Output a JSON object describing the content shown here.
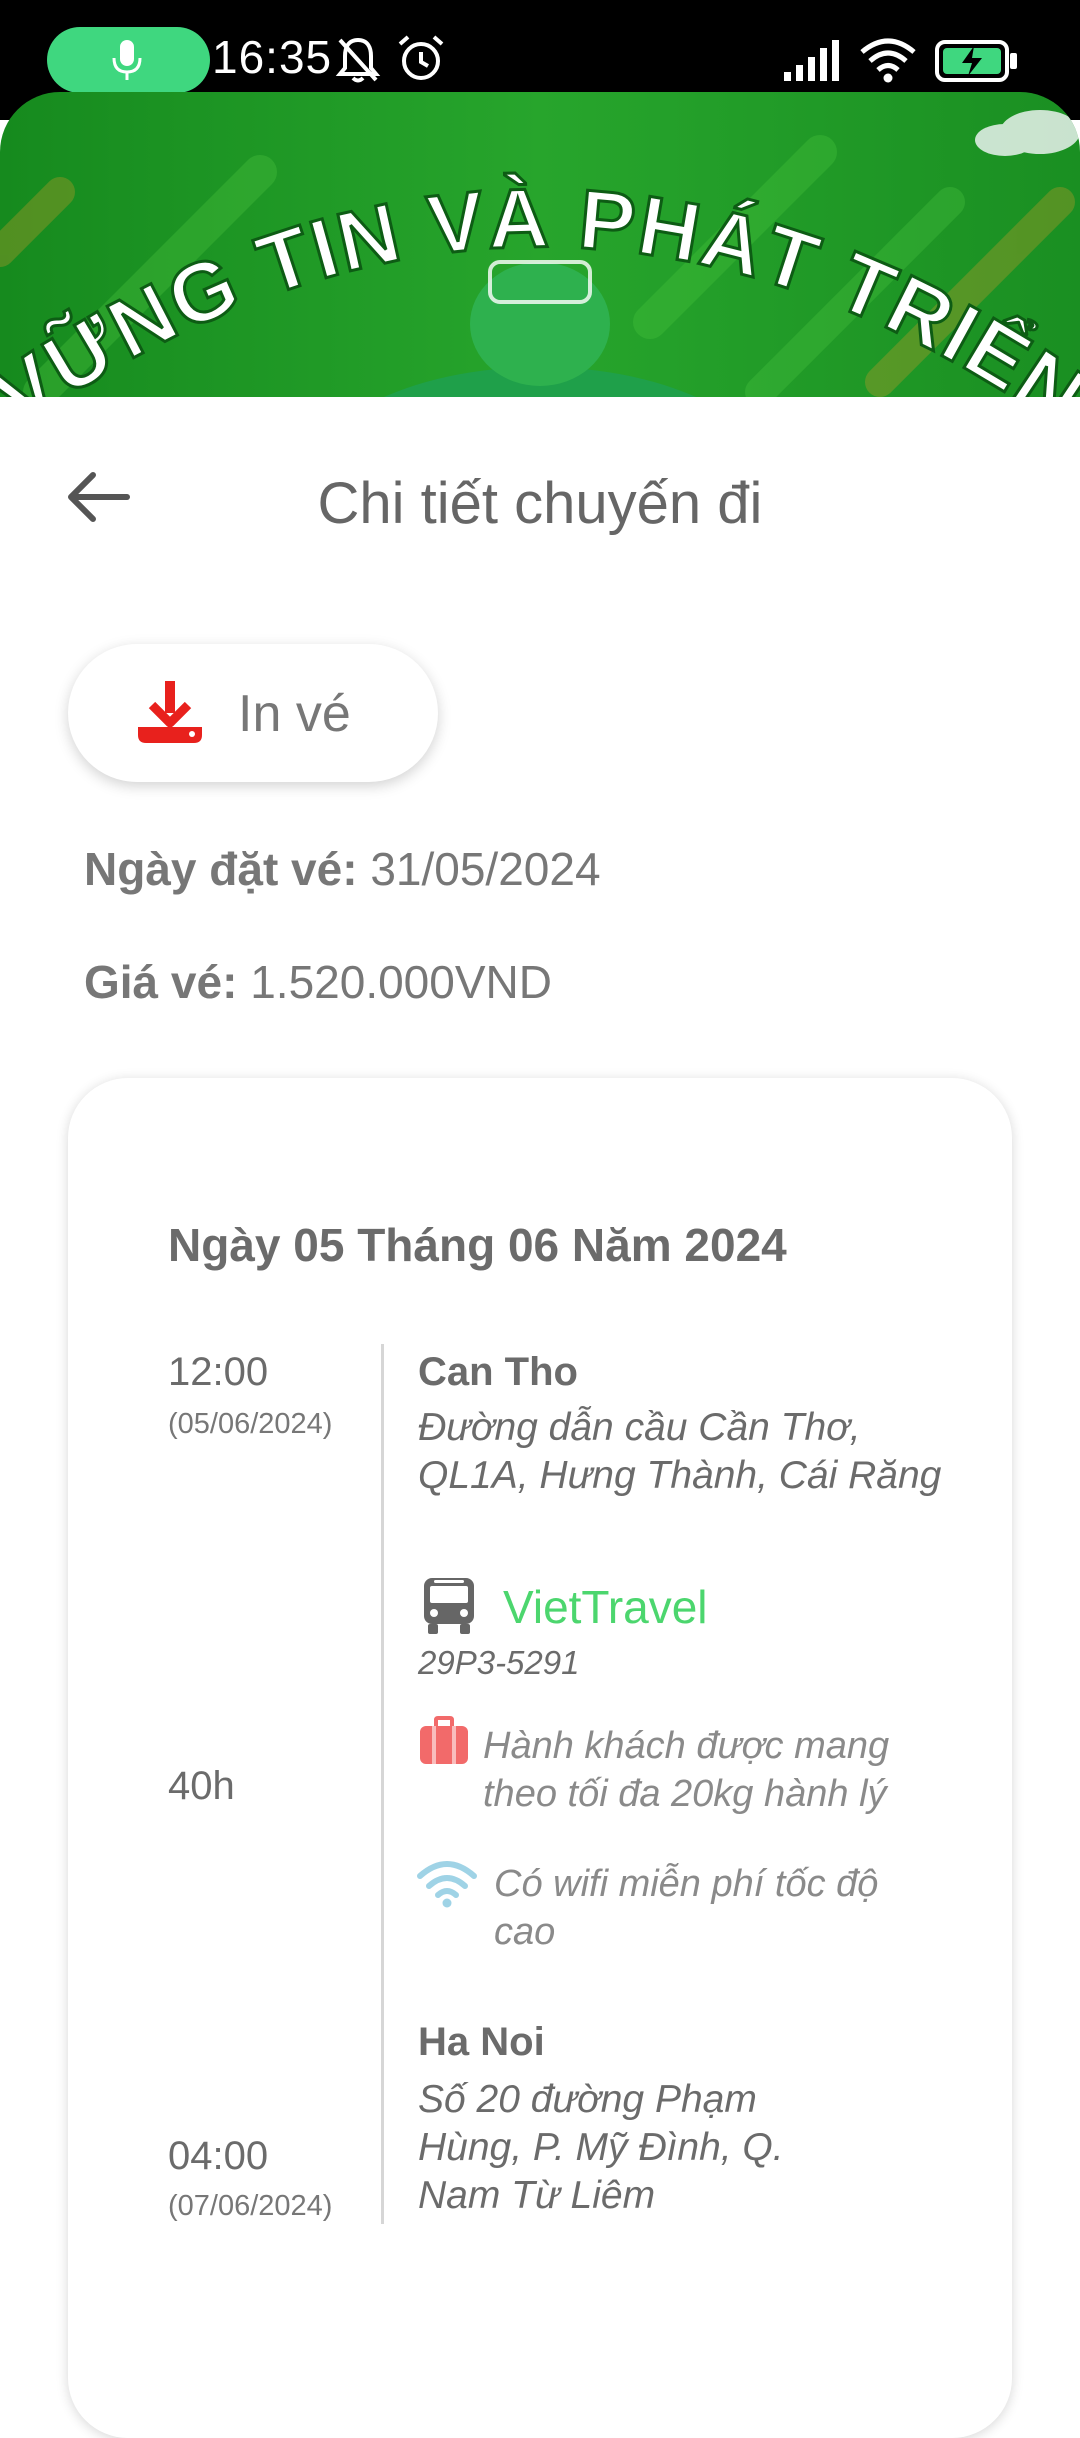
{
  "status_bar": {
    "time": "16:35",
    "accent_color": "#3fd77f",
    "icons": [
      "mic-icon",
      "bell-off-icon",
      "alarm-icon",
      "signal-icon",
      "wifi-icon",
      "battery-charging-icon"
    ]
  },
  "banner": {
    "slogan": "VỮNG TIN VÀ PHÁT TRIỂN",
    "colors": {
      "primary": "#1f8a2a",
      "dark": "#116b1c"
    }
  },
  "header": {
    "title": "Chi tiết chuyến đi",
    "back_icon": "arrow-left-icon"
  },
  "print_button": {
    "label": "In vé",
    "icon": "download-icon",
    "icon_color": "#e8211d"
  },
  "booking": {
    "date_label": "Ngày đặt vé:",
    "date_value": "31/05/2024",
    "price_label": "Giá vé:",
    "price_value": "1.520.000VND"
  },
  "trip": {
    "date_heading": "Ngày 05 Tháng 06 Năm 2024",
    "departure": {
      "time": "12:00",
      "date": "(05/06/2024)",
      "city": "Can Tho",
      "address_line1": "Đường dẫn cầu Cần Thơ,",
      "address_line2": "QL1A, Hưng Thành, Cái Răng"
    },
    "duration": "40h",
    "operator": {
      "name": "VietTravel",
      "plate": "29P3-5291",
      "color": "#4cd66e",
      "icon": "bus-icon"
    },
    "amenities": [
      {
        "icon": "luggage-icon",
        "color": "#f26a6a",
        "line1": "Hành khách được mang",
        "line2": "theo tối đa 20kg hành lý"
      },
      {
        "icon": "wifi-icon",
        "color": "#9fd3e6",
        "line1": "Có wifi miễn phí tốc độ",
        "line2": "cao"
      }
    ],
    "arrival": {
      "time": "04:00",
      "date": "(07/06/2024)",
      "city": "Ha Noi",
      "address_line1": "Số 20 đường Phạm",
      "address_line2": "Hùng, P. Mỹ Đình, Q.",
      "address_line3": "Nam Từ Liêm"
    }
  }
}
